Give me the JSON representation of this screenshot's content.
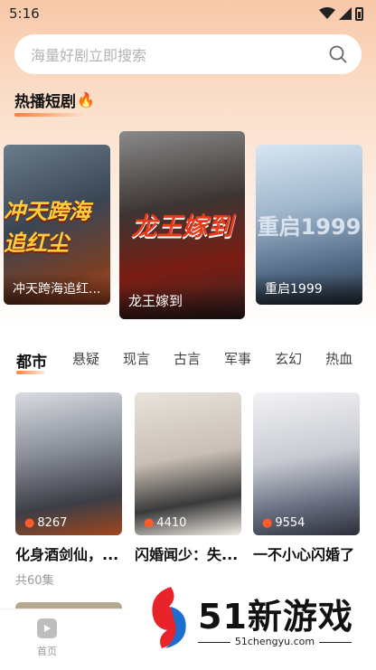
{
  "status_bar": {
    "time": "5:16"
  },
  "search": {
    "placeholder": "海量好剧立即搜索"
  },
  "hot_section": {
    "title": "热播短剧",
    "emoji": "🔥"
  },
  "hot_dramas": [
    {
      "title": "冲天跨海追红...",
      "poster_text": "冲天跨海追红尘"
    },
    {
      "title": "龙王嫁到",
      "poster_text": "龙王嫁到"
    },
    {
      "title": "重启1999",
      "poster_text": "重启1999"
    }
  ],
  "category_tabs": [
    "都市",
    "悬疑",
    "现言",
    "古言",
    "军事",
    "玄幻",
    "热血"
  ],
  "active_tab": "都市",
  "dramas": [
    {
      "title": "化身酒剑仙，...",
      "views": "8267"
    },
    {
      "title": "闪婚闻少：失...",
      "views": "4410"
    },
    {
      "title": "一不小心闪婚了",
      "views": "9554"
    }
  ],
  "episodes": "共60集",
  "bottom_nav": {
    "home_label": "首页"
  },
  "watermark": {
    "brand": "51新游戏",
    "url": "51chengyu.com"
  },
  "colors": {
    "accent": "#ff7e3a",
    "flame": "#ff5a2a"
  }
}
